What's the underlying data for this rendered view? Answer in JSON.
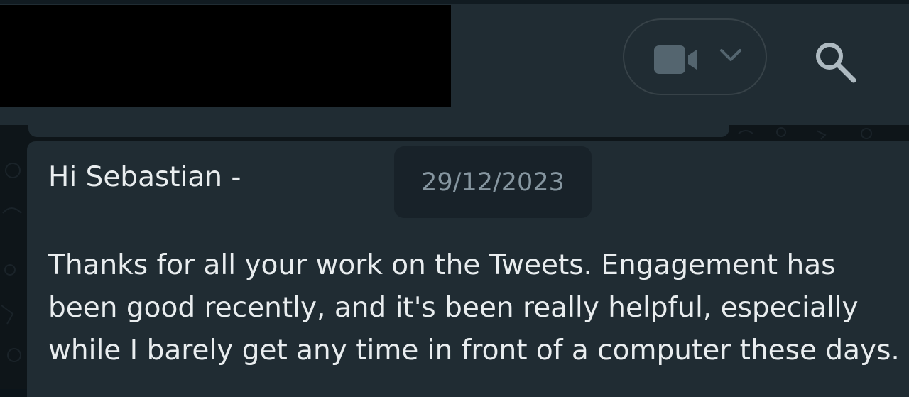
{
  "header": {
    "call_menu": {
      "video_icon": "video-camera-icon",
      "dropdown_icon": "chevron-down-icon"
    },
    "search_icon": "search-icon"
  },
  "date_divider": "29/12/2023",
  "message": {
    "greeting": "Hi Sebastian -",
    "lines": [
      "Thanks for all your work on the Tweets. Engagement has",
      "been good recently, and it's been really helpful, especially",
      "while I barely get any time in front of a computer these days."
    ]
  },
  "colors": {
    "header_bg": "#202c33",
    "bubble_bg": "#202c33",
    "chat_bg": "#0e1519",
    "text_primary": "#e9edef",
    "text_secondary": "#8696a0",
    "icon": "#aebac1"
  }
}
